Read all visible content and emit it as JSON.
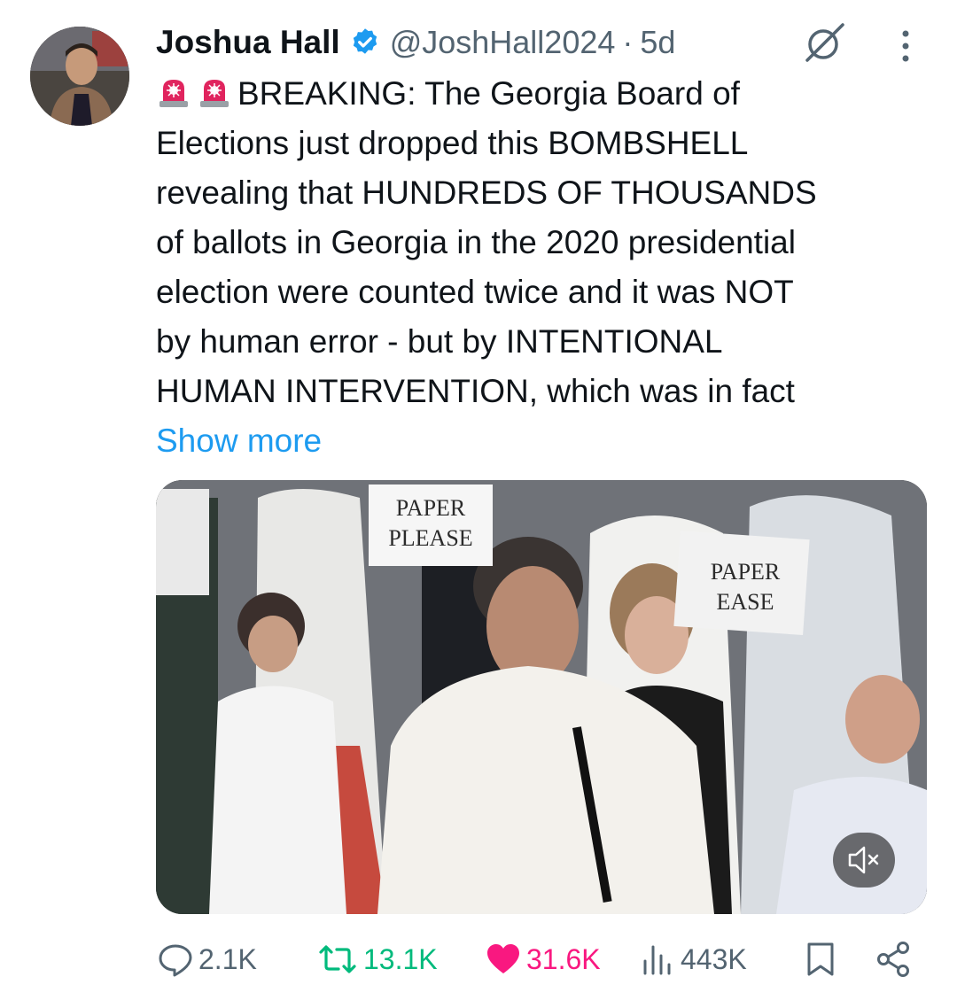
{
  "tweet": {
    "author_name": "Joshua Hall",
    "handle": "@JoshHall2024",
    "separator": "·",
    "time": "5d",
    "text_lines": [
      "BREAKING: The Georgia Board of",
      "Elections just dropped this BOMBSHELL",
      "revealing that HUNDREDS OF THOUSANDS",
      "of ballots in Georgia in the 2020 presidential",
      "election were counted twice and it was NOT",
      "by human error - but by INTENTIONAL",
      "HUMAN INTERVENTION, which was in fact"
    ],
    "show_more": "Show more"
  },
  "media": {
    "signs": [
      "PAPER",
      "PLEASE",
      "PAPER",
      "EASE"
    ]
  },
  "actions": {
    "replies": "2.1K",
    "retweets": "13.1K",
    "likes": "31.6K",
    "views": "443K"
  },
  "colors": {
    "accent": "#1d9bf0",
    "retweet": "#00ba7c",
    "like": "#f91880",
    "muted": "#536471"
  },
  "icons": [
    "verified-badge-icon",
    "grok-icon",
    "more-icon",
    "siren-icon",
    "mute-icon",
    "reply-icon",
    "retweet-icon",
    "like-icon",
    "views-icon",
    "bookmark-icon",
    "share-icon"
  ]
}
